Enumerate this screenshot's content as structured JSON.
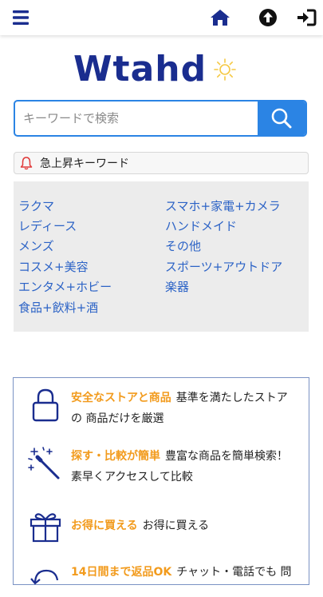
{
  "logo": {
    "text": "Wtahd"
  },
  "search": {
    "placeholder": "キーワードで検索"
  },
  "trending": {
    "label": "急上昇キーワード"
  },
  "categories": {
    "left": [
      "ラクマ",
      "レディース",
      "メンズ",
      "コスメ+美容",
      "エンタメ+ホビー",
      "食品+飲料+酒"
    ],
    "right": [
      "スマホ+家電+カメラ",
      "ハンドメイド",
      "その他",
      "スポーツ+アウトドア",
      "楽器"
    ]
  },
  "features": [
    {
      "icon": "lock-icon",
      "title": "安全なストアと商品",
      "desc": "基準を満たしたストアの 商品だけを厳選"
    },
    {
      "icon": "magic-wand-icon",
      "title": "探す・比較が簡単",
      "desc": "豊富な商品を簡単検索！素早くアクセスして比較"
    },
    {
      "icon": "gift-icon",
      "title": "お得に買える",
      "desc": "お得に買える"
    },
    {
      "icon": "return-icon",
      "title": "14日間まで返品OK",
      "desc": "チャット・電話でも 問"
    }
  ],
  "colors": {
    "brand": "#1a2d8f",
    "accent": "#2b84e4",
    "highlight": "#f29b1d",
    "link": "#2c63c6",
    "sun": "#f5c842"
  }
}
